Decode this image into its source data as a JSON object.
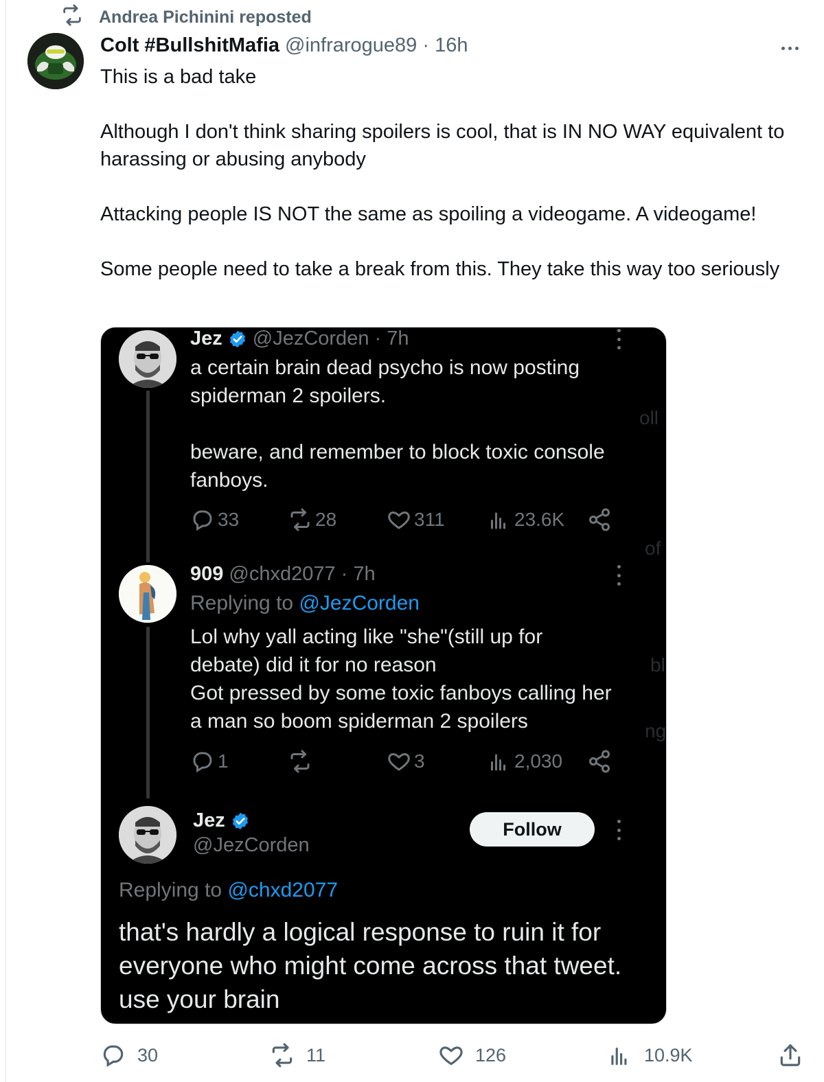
{
  "repost": {
    "label": "Andrea Pichinini reposted",
    "icon": "repost-icon"
  },
  "tweet": {
    "author_name": "Colt #BullshitMafia",
    "meta": "@infrarogue89 · 16h",
    "paragraphs": [
      "This is a bad take",
      "Although I don't think sharing spoilers is cool, that is IN NO WAY equivalent to harassing or abusing anybody",
      "Attacking people IS NOT the same as spoiling a videogame. A videogame!",
      "Some people need to take a break from this. They take this way too seriously"
    ],
    "actions": {
      "replies": "30",
      "reposts": "11",
      "likes": "126",
      "views": "10.9K"
    }
  },
  "embed": {
    "tweet1": {
      "name": "Jez",
      "meta": "@JezCorden · 7h",
      "text1": "a certain brain dead psycho is now posting spiderman 2 spoilers.",
      "text2": "beware, and remember to block toxic console fanboys.",
      "replies": "33",
      "reposts": "28",
      "likes": "311",
      "views": "23.6K"
    },
    "tweet2": {
      "name": "909",
      "meta": "@chxd2077 · 7h",
      "replying_prefix": "Replying to ",
      "replying_handle": "@JezCorden",
      "text": "Lol why yall acting like \"she\"(still up for debate) did it for no reason\nGot pressed by some toxic fanboys calling her a man so boom spiderman 2 spoilers",
      "replies": "1",
      "reposts": "",
      "likes": "3",
      "views": "2,030"
    },
    "tweet3": {
      "name": "Jez",
      "handle": "@JezCorden",
      "follow_label": "Follow",
      "replying_prefix": "Replying to ",
      "replying_handle": "@chxd2077",
      "text": "that's hardly a logical response to ruin it for everyone who might come across that tweet. use your brain"
    }
  },
  "colors": {
    "link": "#1d9bf0",
    "verified": "#1d9bf0",
    "muted": "#536471"
  }
}
